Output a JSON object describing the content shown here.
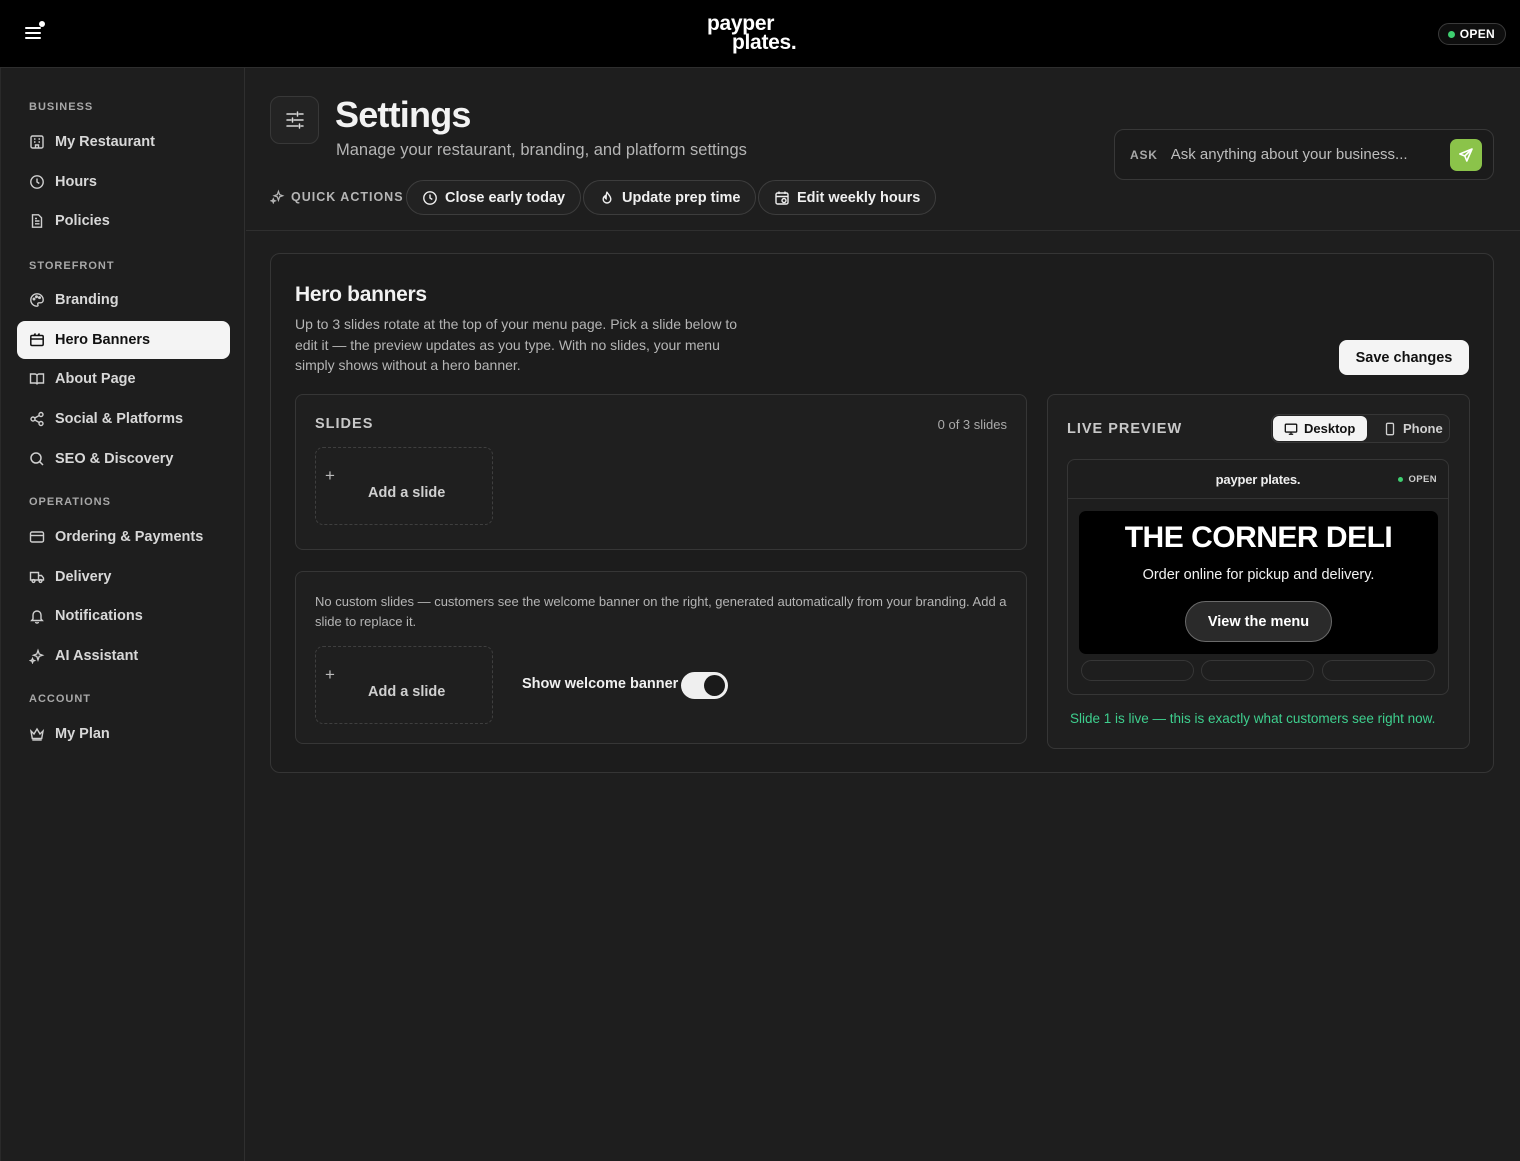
{
  "topbar": {
    "logo_line1": "payper",
    "logo_line2": "plates.",
    "status": "OPEN"
  },
  "sidebar": {
    "sections": [
      {
        "title": "BUSINESS",
        "items": [
          {
            "label": "My Restaurant",
            "icon": "building-icon"
          },
          {
            "label": "Hours",
            "icon": "clock-icon"
          },
          {
            "label": "Policies",
            "icon": "document-icon"
          }
        ]
      },
      {
        "title": "STOREFRONT",
        "items": [
          {
            "label": "Branding",
            "icon": "palette-icon"
          },
          {
            "label": "Hero Banners",
            "icon": "banner-icon",
            "active": true
          },
          {
            "label": "About Page",
            "icon": "book-icon"
          },
          {
            "label": "Social & Platforms",
            "icon": "share-icon"
          },
          {
            "label": "SEO & Discovery",
            "icon": "search-icon"
          }
        ]
      },
      {
        "title": "OPERATIONS",
        "items": [
          {
            "label": "Ordering & Payments",
            "icon": "credit-card-icon"
          },
          {
            "label": "Delivery",
            "icon": "truck-icon"
          },
          {
            "label": "Notifications",
            "icon": "bell-icon"
          },
          {
            "label": "AI Assistant",
            "icon": "sparkles-icon"
          }
        ]
      },
      {
        "title": "ACCOUNT",
        "items": [
          {
            "label": "My Plan",
            "icon": "crown-icon"
          }
        ]
      }
    ]
  },
  "header": {
    "title": "Settings",
    "subtitle": "Manage your restaurant, branding, and platform settings",
    "ask": {
      "label": "ASK",
      "placeholder": "Ask anything about your business..."
    },
    "quick_actions": {
      "label": "QUICK ACTIONS",
      "buttons": [
        {
          "label": "Close early today",
          "icon": "clock-icon"
        },
        {
          "label": "Update prep time",
          "icon": "flame-icon"
        },
        {
          "label": "Edit weekly hours",
          "icon": "calendar-icon"
        }
      ]
    }
  },
  "hero_banners": {
    "title": "Hero banners",
    "description": "Up to 3 slides rotate at the top of your menu page. Pick a slide below to edit it — the preview updates as you type. With no slides, your menu simply shows without a hero banner.",
    "save_label": "Save changes",
    "slides": {
      "title": "SLIDES",
      "count": "0 of 3 slides",
      "add_label": "Add a slide"
    },
    "info": {
      "text": "No custom slides — customers see the welcome banner on the right, generated automatically from your branding. Add a slide to replace it.",
      "add_label": "Add a slide",
      "welcome_label": "Show welcome banner",
      "welcome_on": true
    },
    "preview": {
      "title": "LIVE PREVIEW",
      "modes": [
        "Desktop",
        "Phone"
      ],
      "active_mode": "Desktop",
      "logo": "payper plates.",
      "status": "OPEN",
      "hero_title": "THE CORNER DELI",
      "hero_subtitle": "Order online for pickup and delivery.",
      "hero_button": "View the menu",
      "note": "Slide 1 is live — this is exactly what customers see right now."
    }
  },
  "colors": {
    "accent_green": "#3ecf8e",
    "send_button": "#8bc34a",
    "status_dot": "#3ecf70"
  }
}
